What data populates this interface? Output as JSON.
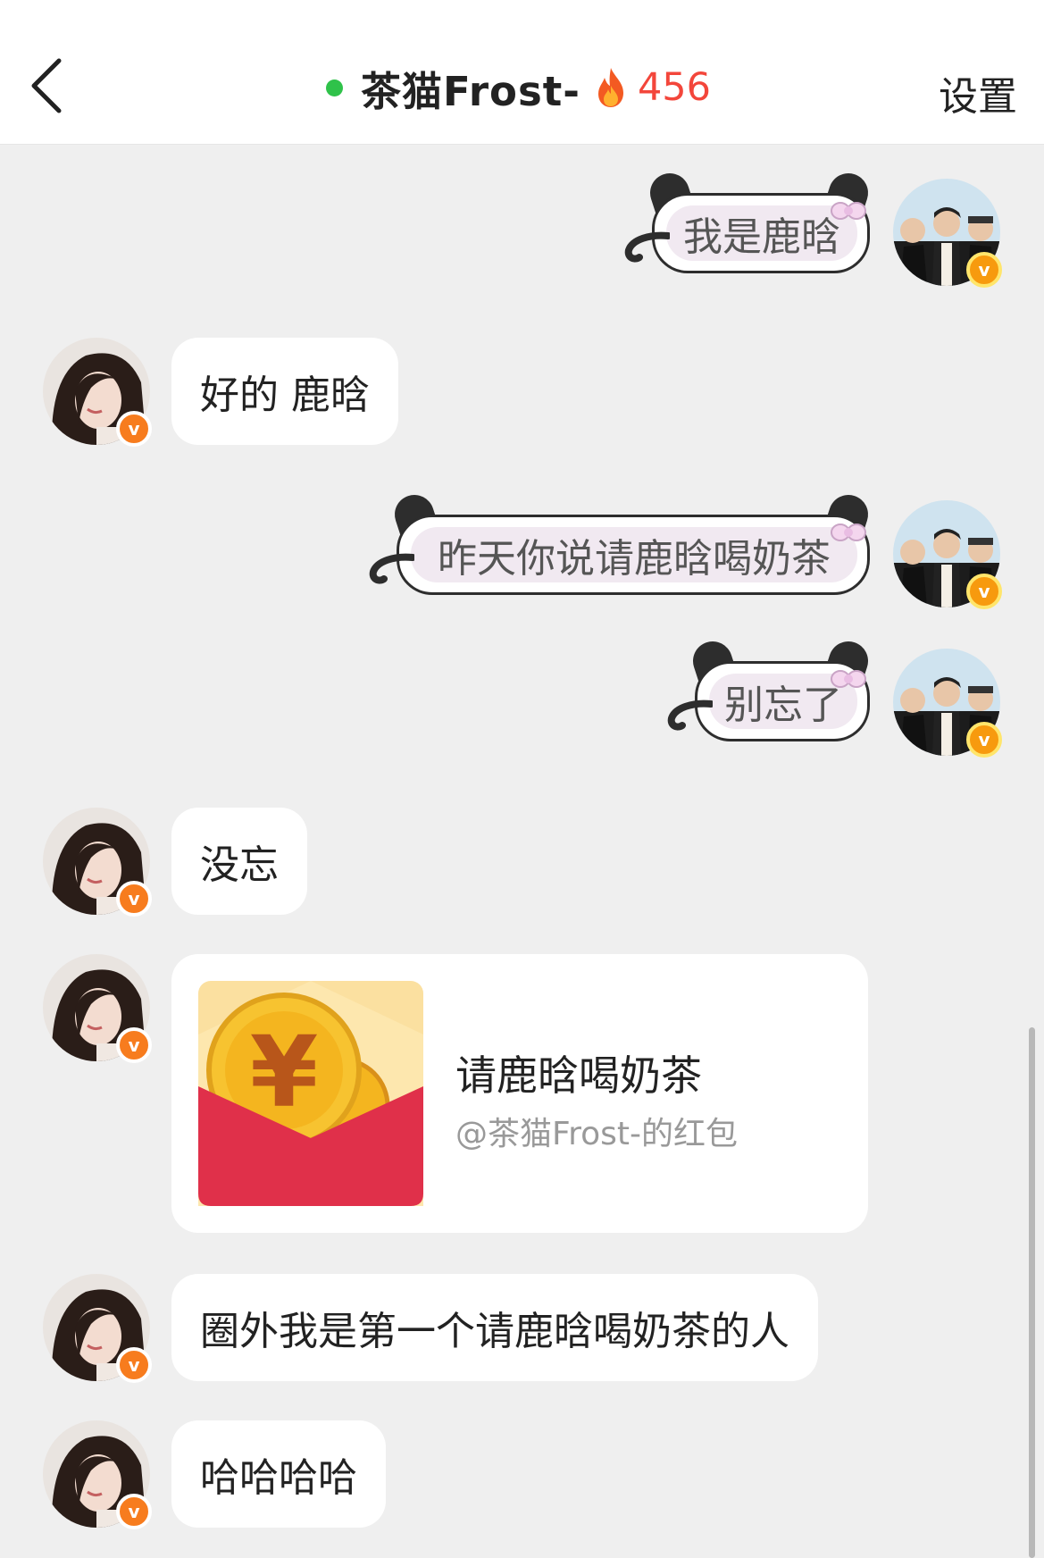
{
  "header": {
    "back_icon": "chevron-left-icon",
    "title": "茶猫Frost-",
    "online_color": "#2fc24a",
    "fire_icon": "fire-icon",
    "fire_count": "456",
    "settings_label": "设置"
  },
  "messages": [
    {
      "side": "right",
      "style": "cat-bubble",
      "text": "我是鹿晗"
    },
    {
      "side": "left",
      "text": "好的 鹿晗"
    },
    {
      "side": "right",
      "style": "cat-bubble",
      "text": "昨天你说请鹿晗喝奶茶"
    },
    {
      "side": "right",
      "style": "cat-bubble",
      "text": "别忘了"
    },
    {
      "side": "left",
      "text": "没忘"
    },
    {
      "side": "left",
      "type": "red-packet",
      "title": "请鹿晗喝奶茶",
      "subtitle": "@茶猫Frost-的红包"
    },
    {
      "side": "left",
      "text": "圈外我是第一个请鹿晗喝奶茶的人"
    },
    {
      "side": "left",
      "text": "哈哈哈哈"
    }
  ],
  "badge": {
    "letter": "v"
  },
  "colors": {
    "accent_red": "#f3463b",
    "envelope_red": "#e0304a",
    "badge_orange": "#f77c1e",
    "bubble_lilac": "#f1e9f1"
  }
}
